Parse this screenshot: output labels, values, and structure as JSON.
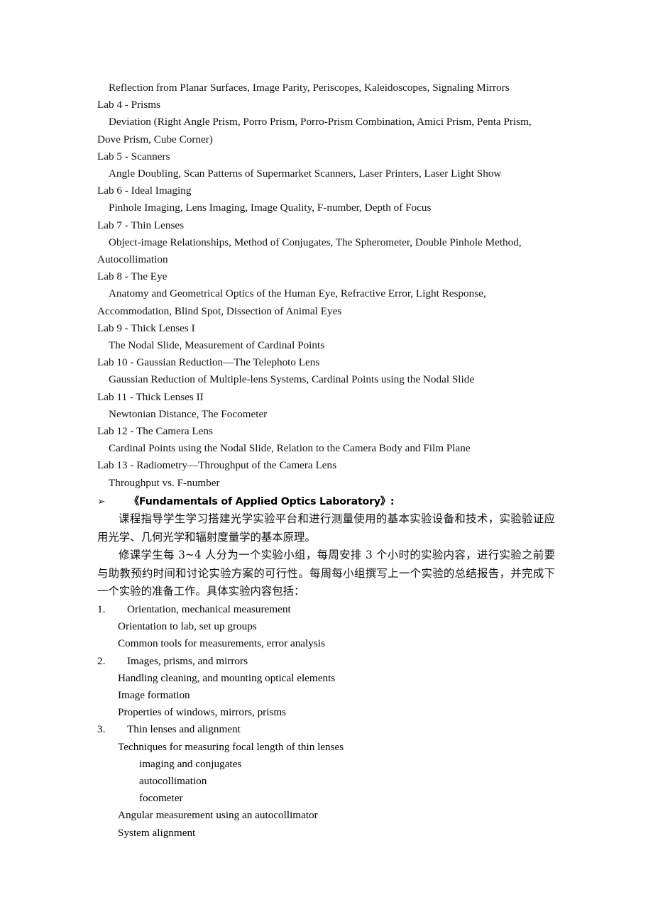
{
  "document": {
    "lab_outline": [
      {
        "kind": "detail",
        "text": "Reflection from Planar Surfaces, Image Parity, Periscopes, Kaleidoscopes, Signaling Mirrors"
      },
      {
        "kind": "heading",
        "text": "Lab 4 - Prisms"
      },
      {
        "kind": "detail",
        "text": "Deviation (Right Angle Prism, Porro Prism, Porro-Prism Combination, Amici Prism, Penta Prism, Dove Prism, Cube Corner)"
      },
      {
        "kind": "heading",
        "text": "Lab 5 - Scanners"
      },
      {
        "kind": "detail",
        "text": "Angle Doubling, Scan Patterns of Supermarket Scanners, Laser Printers, Laser Light Show"
      },
      {
        "kind": "heading",
        "text": "Lab 6 - Ideal Imaging"
      },
      {
        "kind": "detail",
        "text": "Pinhole Imaging, Lens Imaging, Image Quality, F-number, Depth of Focus"
      },
      {
        "kind": "heading",
        "text": "Lab 7 - Thin Lenses"
      },
      {
        "kind": "detail",
        "text": "Object-image Relationships, Method of Conjugates, The Spherometer, Double Pinhole Method, Autocollimation"
      },
      {
        "kind": "heading",
        "text": "Lab 8 - The Eye"
      },
      {
        "kind": "detail",
        "text": "Anatomy and Geometrical Optics of the Human Eye, Refractive Error, Light Response, Accommodation, Blind Spot, Dissection of Animal Eyes"
      },
      {
        "kind": "heading",
        "text": "Lab 9 - Thick Lenses I"
      },
      {
        "kind": "detail",
        "text": "The Nodal Slide, Measurement of Cardinal Points"
      },
      {
        "kind": "heading",
        "text": "Lab 10 - Gaussian Reduction—The Telephoto Lens"
      },
      {
        "kind": "detail",
        "text": "Gaussian Reduction of Multiple-lens Systems, Cardinal Points using the Nodal Slide"
      },
      {
        "kind": "heading",
        "text": "Lab 11 - Thick Lenses II"
      },
      {
        "kind": "detail",
        "text": "Newtonian Distance, The Focometer"
      },
      {
        "kind": "heading",
        "text": "Lab 12 - The Camera Lens"
      },
      {
        "kind": "detail",
        "text": "Cardinal Points using the Nodal Slide, Relation to the Camera Body and Film Plane"
      },
      {
        "kind": "heading",
        "text": "Lab 13 - Radiometry—Throughput of the Camera Lens"
      },
      {
        "kind": "detail",
        "text": "Throughput vs. F-number"
      }
    ],
    "section": {
      "bullet_glyph": "➢",
      "title": "《Fundamentals of Applied Optics Laboratory》:",
      "paragraphs": [
        "课程指导学生学习搭建光学实验平台和进行测量使用的基本实验设备和技术，实验验证应用光学、几何光学和辐射度量学的基本原理。",
        "修课学生每 3~4 人分为一个实验小组，每周安排 3 个小时的实验内容，进行实验之前要与助教预约时间和讨论实验方案的可行性。每周每小组撰写上一个实验的总结报告，并完成下一个实验的准备工作。具体实验内容包括："
      ]
    },
    "experiment_list": [
      {
        "number": "1.",
        "title": "Orientation, mechanical measurement",
        "subitems": [
          {
            "level": 1,
            "text": "Orientation to lab, set up groups"
          },
          {
            "level": 1,
            "text": "Common tools for measurements, error analysis"
          }
        ]
      },
      {
        "number": "2.",
        "title": "Images, prisms, and mirrors",
        "subitems": [
          {
            "level": 1,
            "text": "Handling cleaning, and mounting optical elements"
          },
          {
            "level": 1,
            "text": "Image formation"
          },
          {
            "level": 1,
            "text": "Properties of windows, mirrors, prisms"
          }
        ]
      },
      {
        "number": "3.",
        "title": "Thin lenses and alignment",
        "subitems": [
          {
            "level": 1,
            "text": "Techniques for measuring focal length of thin lenses"
          },
          {
            "level": 2,
            "text": "imaging and conjugates"
          },
          {
            "level": 2,
            "text": "autocollimation"
          },
          {
            "level": 2,
            "text": "focometer"
          },
          {
            "level": 1,
            "text": "Angular measurement using an autocollimator"
          },
          {
            "level": 1,
            "text": "System alignment"
          }
        ]
      }
    ]
  }
}
